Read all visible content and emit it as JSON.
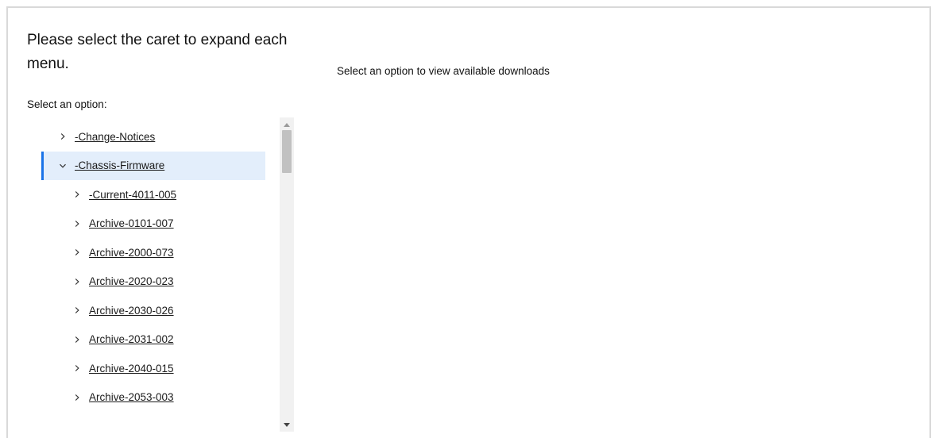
{
  "heading": "Please select the caret to expand each menu.",
  "select_label": "Select an option:",
  "downloads_message": "Select an option to view available downloads",
  "tree": {
    "items": [
      {
        "label": "-Change-Notices",
        "level": 0,
        "expanded": false,
        "selected": false
      },
      {
        "label": "-Chassis-Firmware",
        "level": 0,
        "expanded": true,
        "selected": true
      },
      {
        "label": "-Current-4011-005",
        "level": 1,
        "expanded": false,
        "selected": false
      },
      {
        "label": "Archive-0101-007",
        "level": 1,
        "expanded": false,
        "selected": false
      },
      {
        "label": "Archive-2000-073",
        "level": 1,
        "expanded": false,
        "selected": false
      },
      {
        "label": "Archive-2020-023",
        "level": 1,
        "expanded": false,
        "selected": false
      },
      {
        "label": "Archive-2030-026",
        "level": 1,
        "expanded": false,
        "selected": false
      },
      {
        "label": "Archive-2031-002",
        "level": 1,
        "expanded": false,
        "selected": false
      },
      {
        "label": "Archive-2040-015",
        "level": 1,
        "expanded": false,
        "selected": false
      },
      {
        "label": "Archive-2053-003",
        "level": 1,
        "expanded": false,
        "selected": false
      }
    ]
  },
  "icons": {
    "collapsed": "chevron-right-icon",
    "expanded": "chevron-down-icon",
    "scroll_up": "scroll-up-arrow-icon",
    "scroll_down": "scroll-down-arrow-icon"
  },
  "colors": {
    "selected_background": "#e3eefb",
    "selected_accent": "#1a73e8",
    "frame_border": "#d9d9d9",
    "scrollbar_track": "#f1f1f1",
    "scrollbar_thumb": "#c1c1c1"
  }
}
